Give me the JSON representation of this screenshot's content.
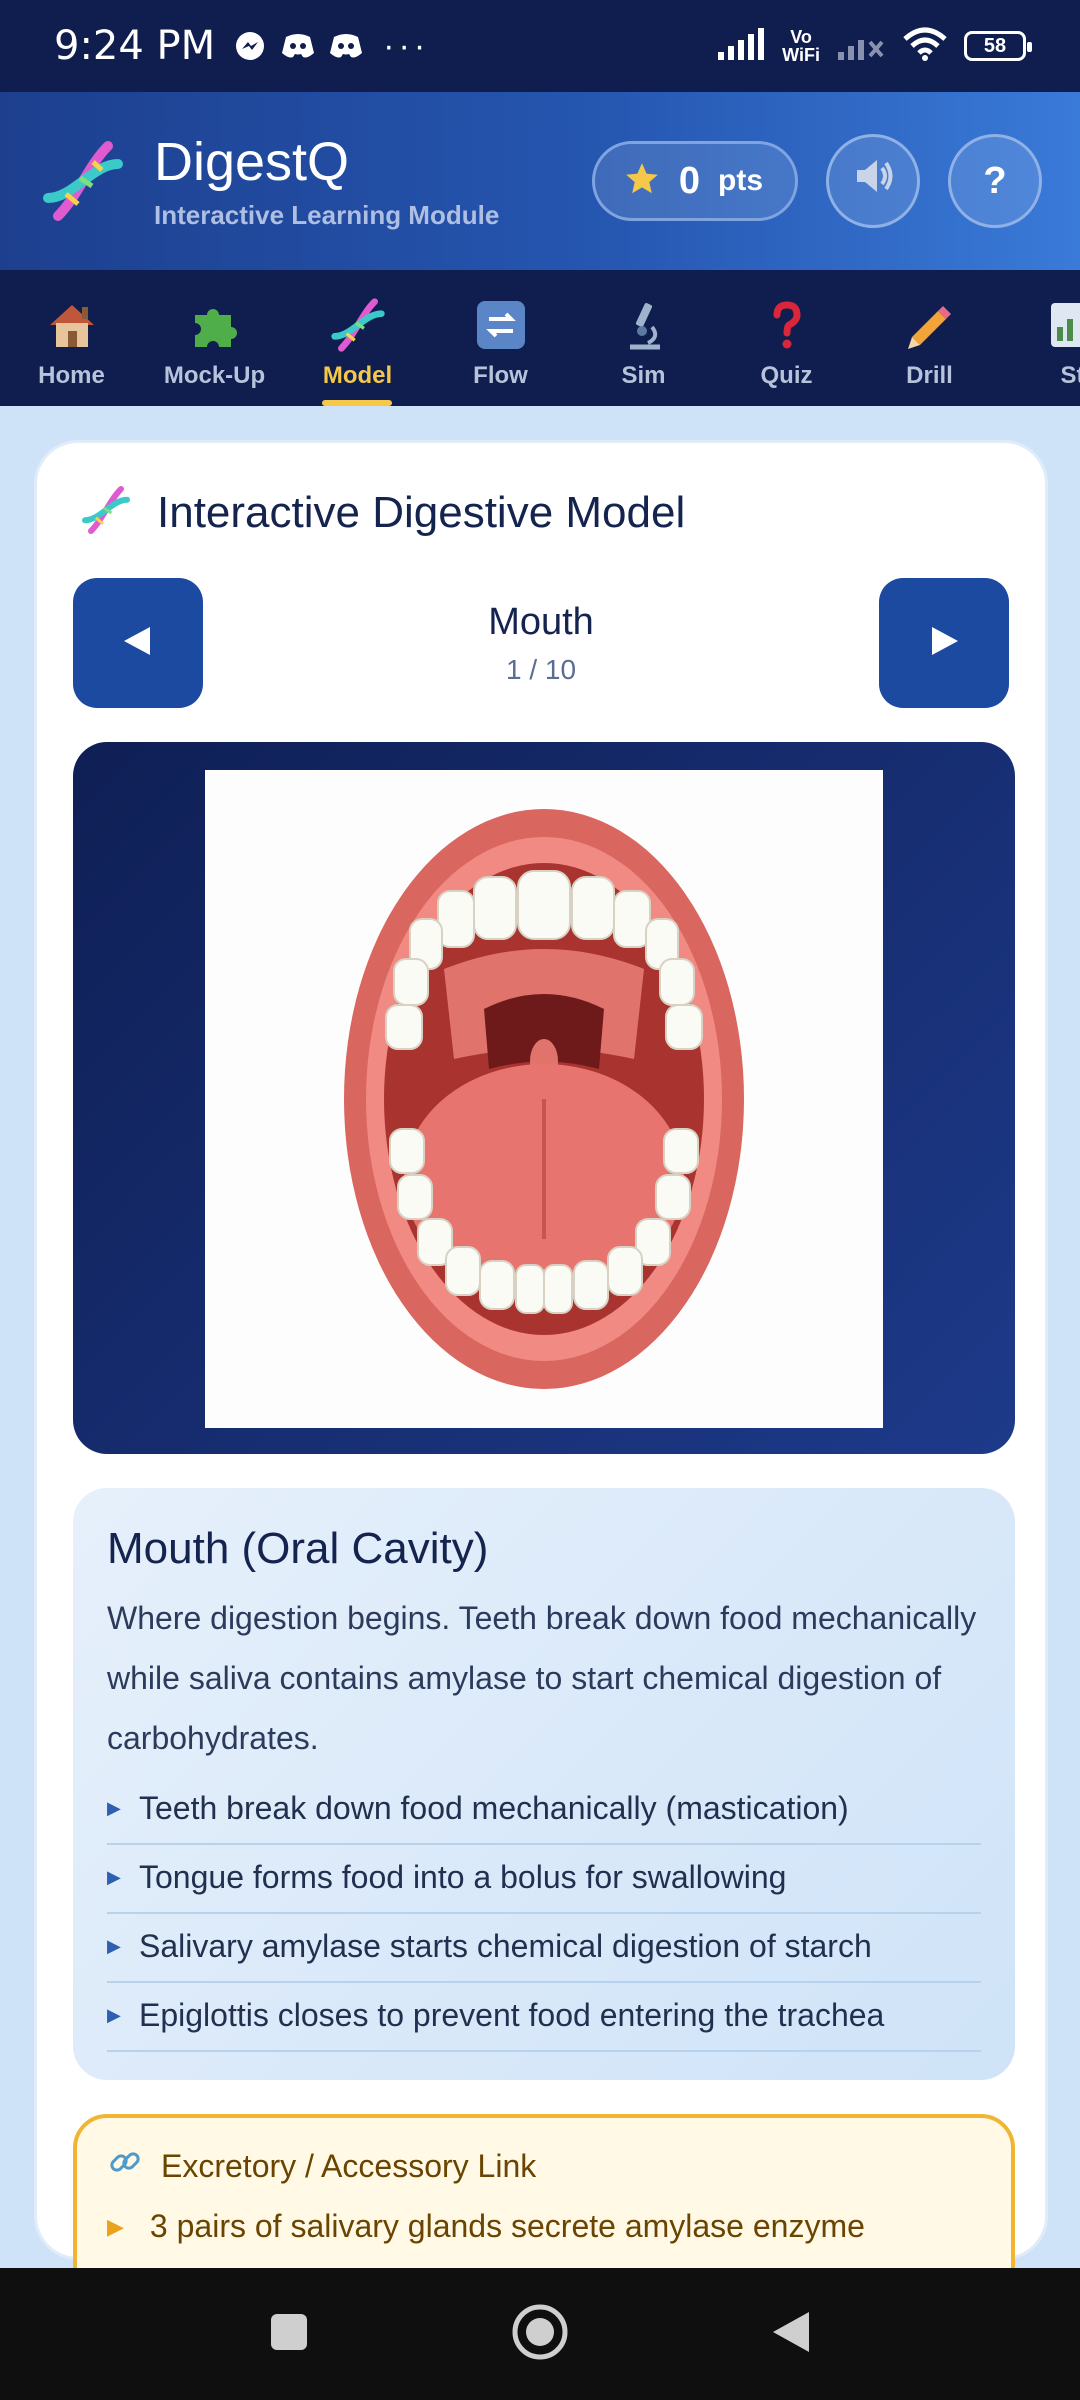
{
  "status_bar": {
    "time": "9:24 PM",
    "dots": "···",
    "vowifi_top": "Vo",
    "vowifi_bottom": "WiFi",
    "battery": "58",
    "icons": [
      "messenger-icon",
      "discord-icon",
      "discord-icon",
      "signal-icon",
      "vowifi-icon",
      "signal-off-icon",
      "wifi-icon",
      "battery-icon"
    ]
  },
  "header": {
    "title": "DigestQ",
    "subtitle": "Interactive Learning Module",
    "points_value": "0",
    "points_label": "pts",
    "help_label": "?"
  },
  "nav": {
    "items": [
      {
        "label": "Home",
        "icon": "house-icon"
      },
      {
        "label": "Mock-Up",
        "icon": "puzzle-icon"
      },
      {
        "label": "Model",
        "icon": "dna-icon",
        "active": true
      },
      {
        "label": "Flow",
        "icon": "cycle-icon"
      },
      {
        "label": "Sim",
        "icon": "microscope-icon"
      },
      {
        "label": "Quiz",
        "icon": "question-icon"
      },
      {
        "label": "Drill",
        "icon": "pencil-icon"
      },
      {
        "label": "St",
        "icon": "chart-icon"
      }
    ]
  },
  "model": {
    "title": "Interactive Digestive Model",
    "organ_name": "Mouth",
    "counter": "1 / 10"
  },
  "info": {
    "title": "Mouth (Oral Cavity)",
    "description": "Where digestion begins. Teeth break down food mechanically while saliva contains amylase to start chemical digestion of carbohydrates.",
    "bullets": [
      "Teeth break down food mechanically (mastication)",
      "Tongue forms food into a bolus for swallowing",
      "Salivary amylase starts chemical digestion of starch",
      "Epiglottis closes to prevent food entering the trachea"
    ]
  },
  "link": {
    "title": "Excretory / Accessory Link",
    "items": [
      "3 pairs of salivary glands secrete amylase enzyme"
    ]
  },
  "colors": {
    "header_dark": "#0f1d4f",
    "accent_blue": "#1c4aa0",
    "active_tab": "#f5c84a",
    "link_border": "#f0b633"
  }
}
